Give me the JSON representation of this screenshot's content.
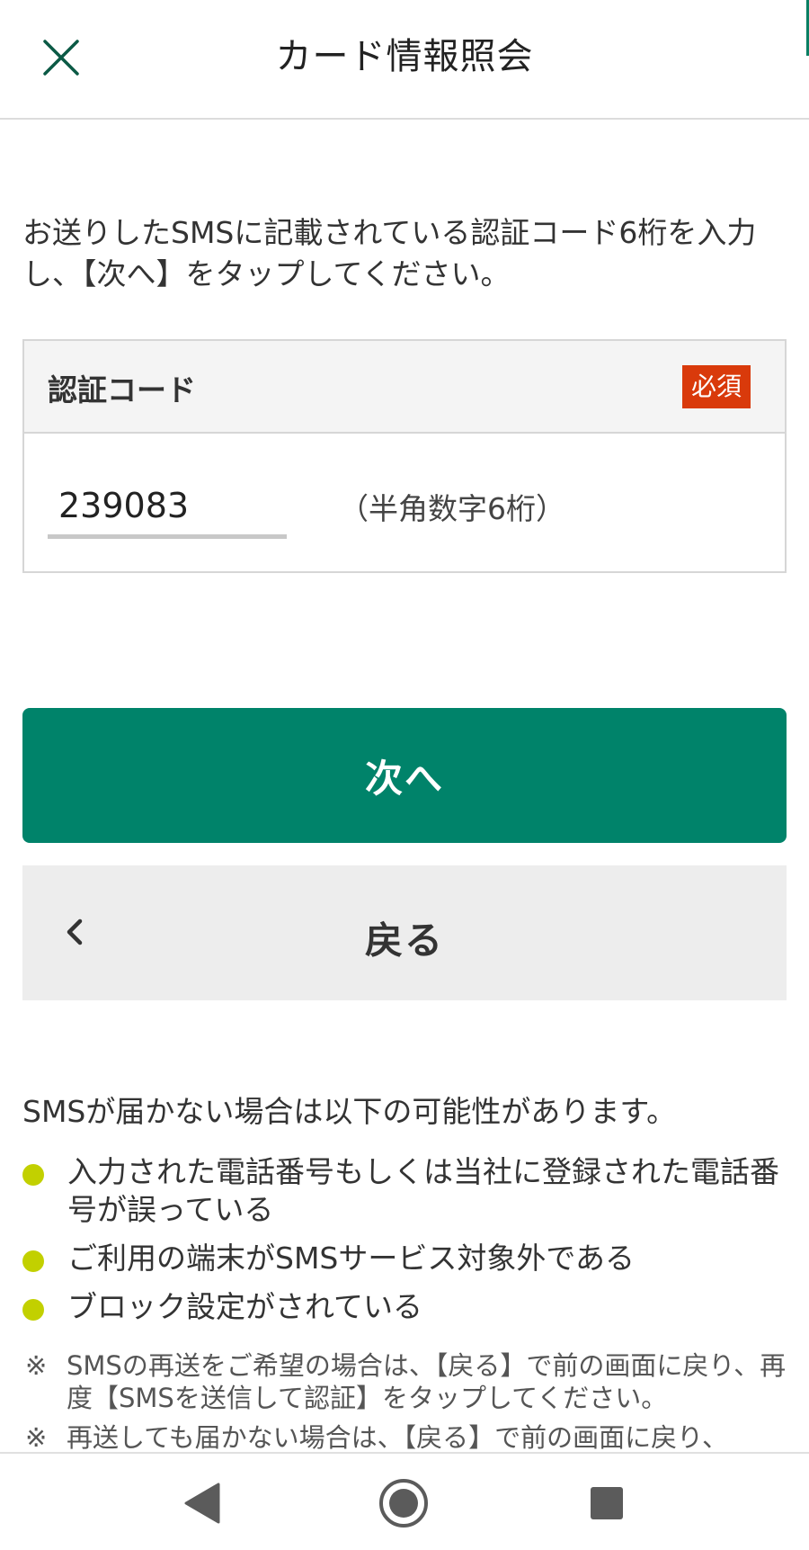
{
  "header": {
    "title": "カード情報照会",
    "close_icon": "close-icon"
  },
  "instruction": "お送りしたSMSに記載されている認証コード6桁を入力し、【次へ】をタップしてください。",
  "form": {
    "label": "認証コード",
    "required_badge": "必須",
    "code_value": "239083",
    "hint": "（半角数字6桁）"
  },
  "buttons": {
    "next_label": "次へ",
    "back_label": "戻る"
  },
  "notes": {
    "heading": "SMSが届かない場合は以下の可能性があります。",
    "bullets": [
      "入力された電話番号もしくは当社に登録された電話番号が誤っている",
      "ご利用の端末がSMSサービス対象外である",
      "ブロック設定がされている"
    ],
    "remark_mark": "※",
    "remarks": [
      "SMSの再送をご希望の場合は、【戻る】で前の画面に戻り、再度【SMSを送信して認証】をタップしてください。",
      "再送しても届かない場合は、【戻る】で前の画面に戻り、"
    ]
  },
  "colors": {
    "primary": "#00836a",
    "required": "#d93a0b",
    "bullet": "#c2d000",
    "back_button_bg": "#ededed"
  },
  "system_nav": {
    "back_icon": "triangle-back-icon",
    "home_icon": "home-circle-icon",
    "recents_icon": "square-recents-icon"
  }
}
